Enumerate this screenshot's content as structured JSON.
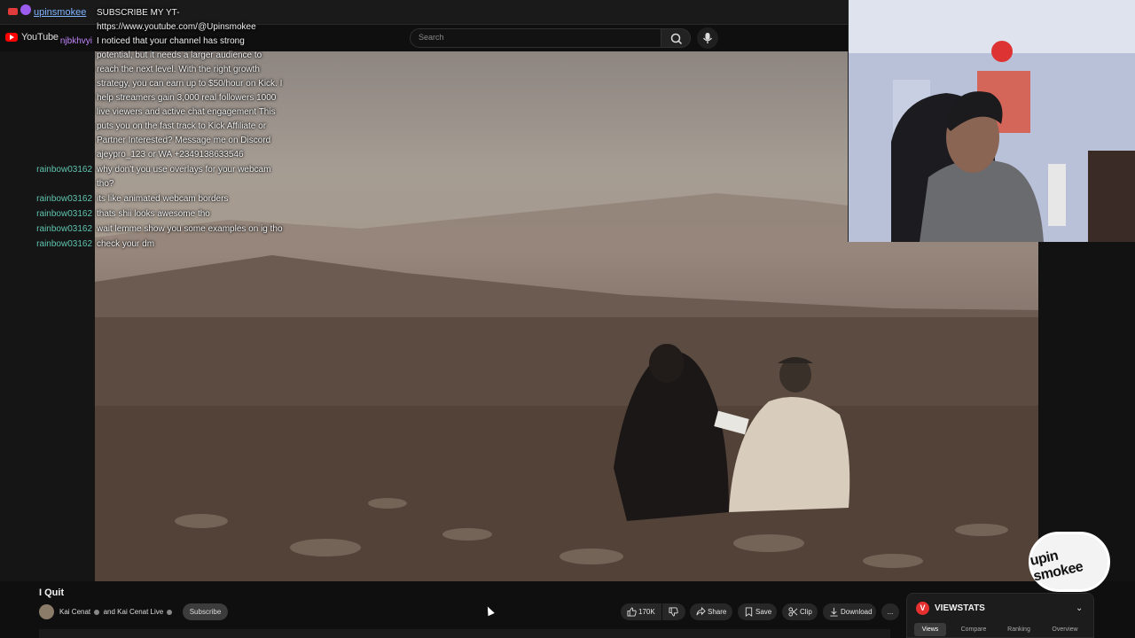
{
  "browser": {
    "channel": "upinsmokee"
  },
  "header": {
    "logo": "YouTube",
    "search_placeholder": "Search"
  },
  "chat": [
    {
      "user": "",
      "text": "SUBSCRIBE MY YT-"
    },
    {
      "user": "",
      "text": "https://www.youtube.com/@Upinsmokee"
    },
    {
      "user": "njbkhvyi",
      "text": "I noticed that your channel has strong"
    },
    {
      "user": "",
      "text": "potential, but it needs a larger audience to"
    },
    {
      "user": "",
      "text": "reach the next level. With the right growth"
    },
    {
      "user": "",
      "text": "strategy, you can earn up to $50/hour on Kick. I"
    },
    {
      "user": "",
      "text": "help streamers gain 3,000 real followers 1000"
    },
    {
      "user": "",
      "text": "live viewers and active chat engagement This"
    },
    {
      "user": "",
      "text": "puts you on the fast track to Kick Affiliate or"
    },
    {
      "user": "",
      "text": "Partner Interested? Message me on Discord"
    },
    {
      "user": "",
      "text": "ajeypro_123 or WA +2349138633546"
    },
    {
      "user": "rainbow03162",
      "text": "why don't you use overlays for your webcam"
    },
    {
      "user": "",
      "text": "tho?"
    },
    {
      "user": "rainbow03162",
      "text": "its like animated webcam borders"
    },
    {
      "user": "rainbow03162",
      "text": "thats shii looks awesome tho"
    },
    {
      "user": "rainbow03162",
      "text": "wait lemme show you some examples on ig tho"
    },
    {
      "user": "rainbow03162",
      "text": "check your dm"
    }
  ],
  "video": {
    "title": "I Quit",
    "channel": "Kai Cenat",
    "channel_and": "and Kai Cenat Live",
    "subscribe_label": "Subscribe",
    "likes": "170K",
    "share_label": "Share",
    "save_label": "Save",
    "clip_label": "Clip",
    "download_label": "Download",
    "more_label": "..."
  },
  "watermark": "upin smokee",
  "viewstats": {
    "logo": "V",
    "title": "VIEWSTATS",
    "tabs": [
      "Views",
      "Compare",
      "Ranking",
      "Overview"
    ],
    "active_tab": "Views"
  }
}
